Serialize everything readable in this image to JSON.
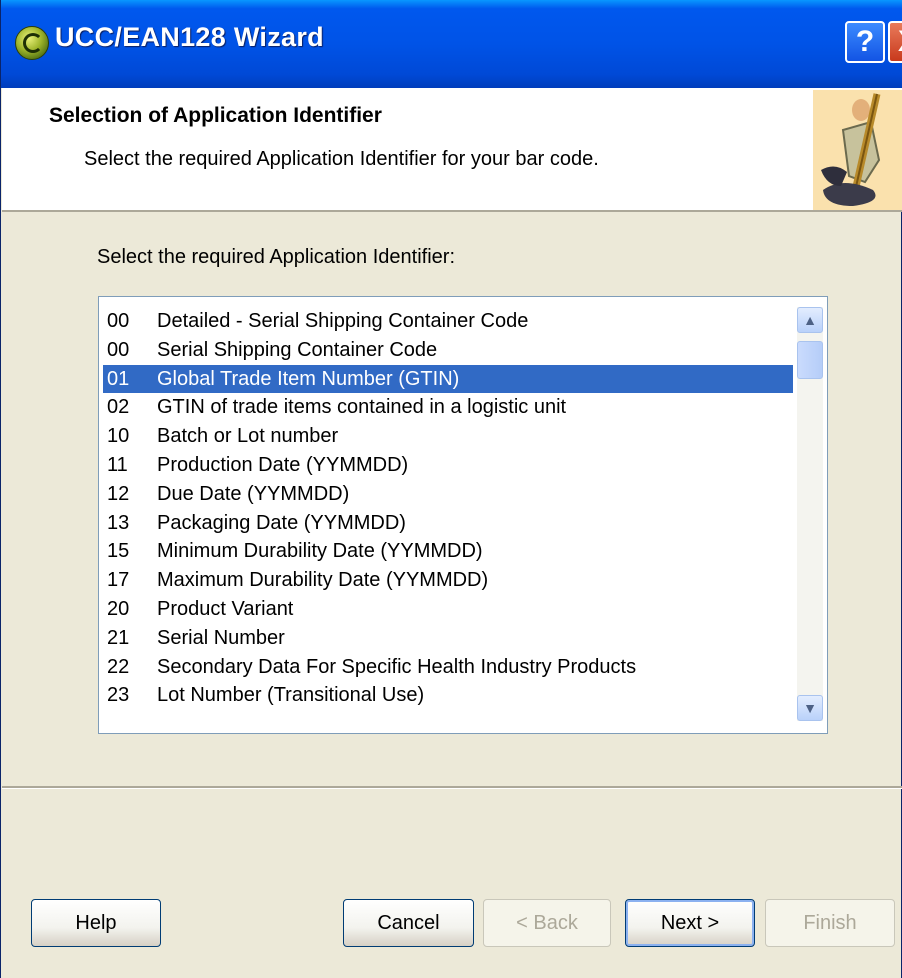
{
  "window": {
    "title": "UCC/EAN128 Wizard",
    "help_button": "?",
    "close_button": "X"
  },
  "header": {
    "title": "Selection of Application Identifier",
    "subtitle": "Select the required Application Identifier for your bar code."
  },
  "main": {
    "prompt": "Select the required Application Identifier:",
    "list": {
      "items": [
        {
          "code": "00",
          "name": "Detailed - Serial Shipping Container Code"
        },
        {
          "code": "00",
          "name": "Serial Shipping Container Code"
        },
        {
          "code": "01",
          "name": "Global Trade Item Number (GTIN)"
        },
        {
          "code": "02",
          "name": "GTIN of trade items contained in a logistic unit"
        },
        {
          "code": "10",
          "name": "Batch or Lot number"
        },
        {
          "code": "11",
          "name": "Production Date (YYMMDD)"
        },
        {
          "code": "12",
          "name": "Due Date (YYMMDD)"
        },
        {
          "code": "13",
          "name": "Packaging Date (YYMMDD)"
        },
        {
          "code": "15",
          "name": "Minimum Durability Date (YYMMDD)"
        },
        {
          "code": "17",
          "name": "Maximum Durability Date (YYMMDD)"
        },
        {
          "code": "20",
          "name": "Product Variant"
        },
        {
          "code": "21",
          "name": "Serial Number"
        },
        {
          "code": "22",
          "name": "Secondary Data For Specific Health Industry Products"
        },
        {
          "code": "23",
          "name": "Lot Number (Transitional Use)"
        }
      ],
      "selected_index": 2
    }
  },
  "buttons": {
    "help": "Help",
    "cancel": "Cancel",
    "back": "< Back",
    "next": "Next >",
    "finish": "Finish"
  },
  "colors": {
    "selection": "#316AC5",
    "titlebar": "#0053E7",
    "dialog": "#ECE9D8"
  },
  "icons": {
    "app": "wizard-app-icon",
    "header_art": "wizard-figure-icon",
    "scroll_up": "chevron-up-icon",
    "scroll_down": "chevron-down-icon"
  }
}
